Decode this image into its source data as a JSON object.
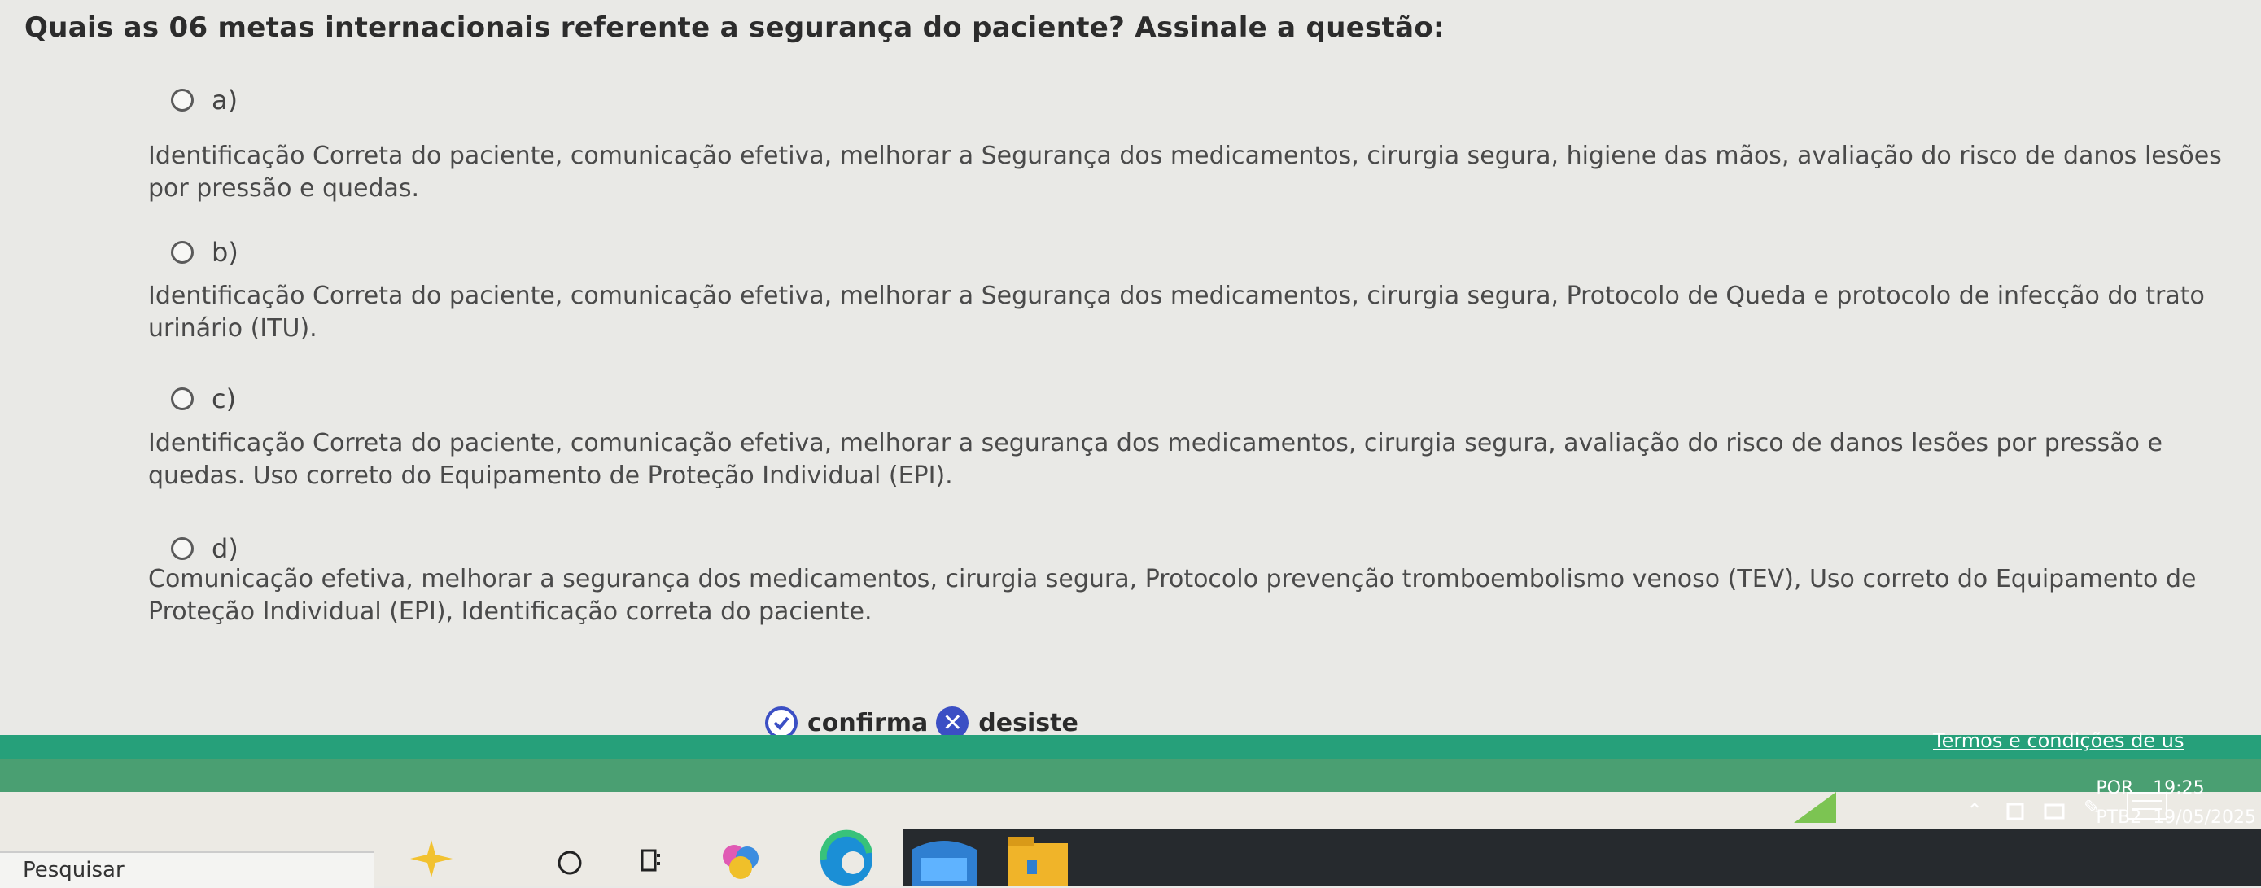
{
  "question": "Quais as 06 metas internacionais referente a segurança do paciente? Assinale a questão:",
  "options": [
    {
      "letter": "a)",
      "text": "Identificação Correta do paciente, comunicação efetiva, melhorar a Segurança dos medicamentos, cirurgia segura, higiene das mãos, avaliação do risco de danos lesões por pressão e quedas."
    },
    {
      "letter": "b)",
      "text": "Identificação Correta do paciente, comunicação efetiva, melhorar a Segurança dos medicamentos, cirurgia segura, Protocolo de Queda e protocolo de infecção do trato urinário (ITU)."
    },
    {
      "letter": "c)",
      "text": "Identificação Correta do paciente, comunicação efetiva, melhorar a segurança dos medicamentos, cirurgia segura, avaliação do risco de danos lesões por pressão e quedas. Uso correto do Equipamento de Proteção Individual (EPI)."
    },
    {
      "letter": "d)",
      "text": "Comunicação efetiva, melhorar a segurança dos medicamentos, cirurgia segura, Protocolo prevenção tromboembolismo venoso (TEV), Uso correto do Equipamento de Proteção Individual (EPI), Identificação correta do paciente."
    }
  ],
  "actions": {
    "confirm_label": "confirma",
    "cancel_label": "desiste"
  },
  "footer": {
    "terms_label": "Termos e condições de us"
  },
  "taskbar": {
    "search_placeholder": "Pesquisar",
    "language": "POR",
    "keyboard": "PTB2",
    "time": "19:25",
    "date": "19/05/2025"
  },
  "colors": {
    "accent_blue": "#3b4fc4",
    "footer_green": "#26a07a",
    "taskbar_dark": "#262a2e"
  }
}
